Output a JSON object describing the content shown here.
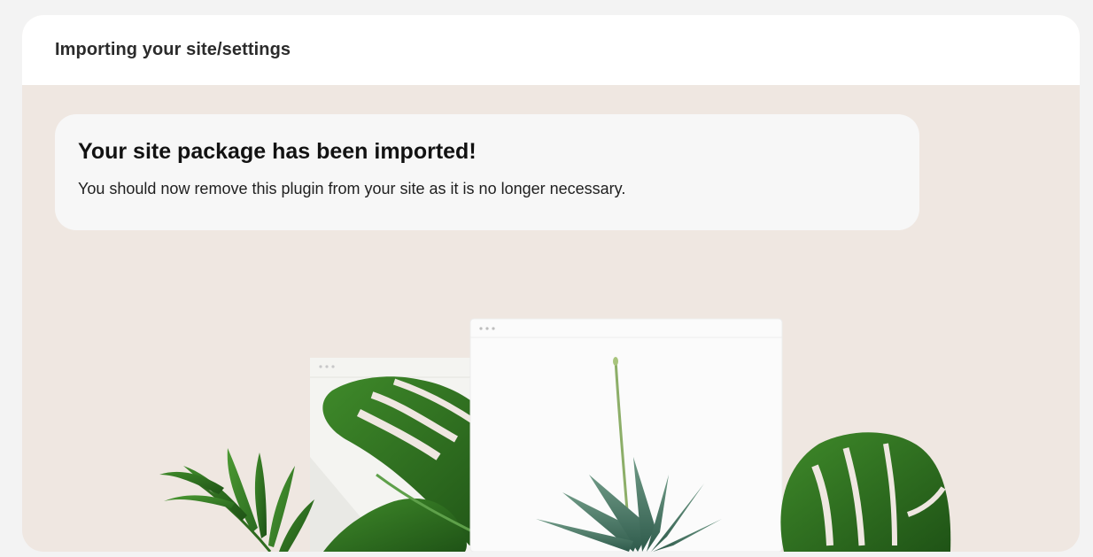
{
  "panel": {
    "title": "Importing your site/settings"
  },
  "notice": {
    "heading": "Your site package has been imported!",
    "message": "You should now remove this plugin from your site as it is no longer necessary."
  },
  "colors": {
    "page_background": "#f3f3f3",
    "panel_background": "#efe7e1",
    "header_background": "#ffffff",
    "notice_background": "#f7f7f7",
    "leaf_green": "#2f6b1f"
  },
  "illustration": {
    "icons": [
      "palm-leaf-icon",
      "monstera-leaf-icon",
      "aloe-plant-icon",
      "browser-window-icon"
    ]
  }
}
